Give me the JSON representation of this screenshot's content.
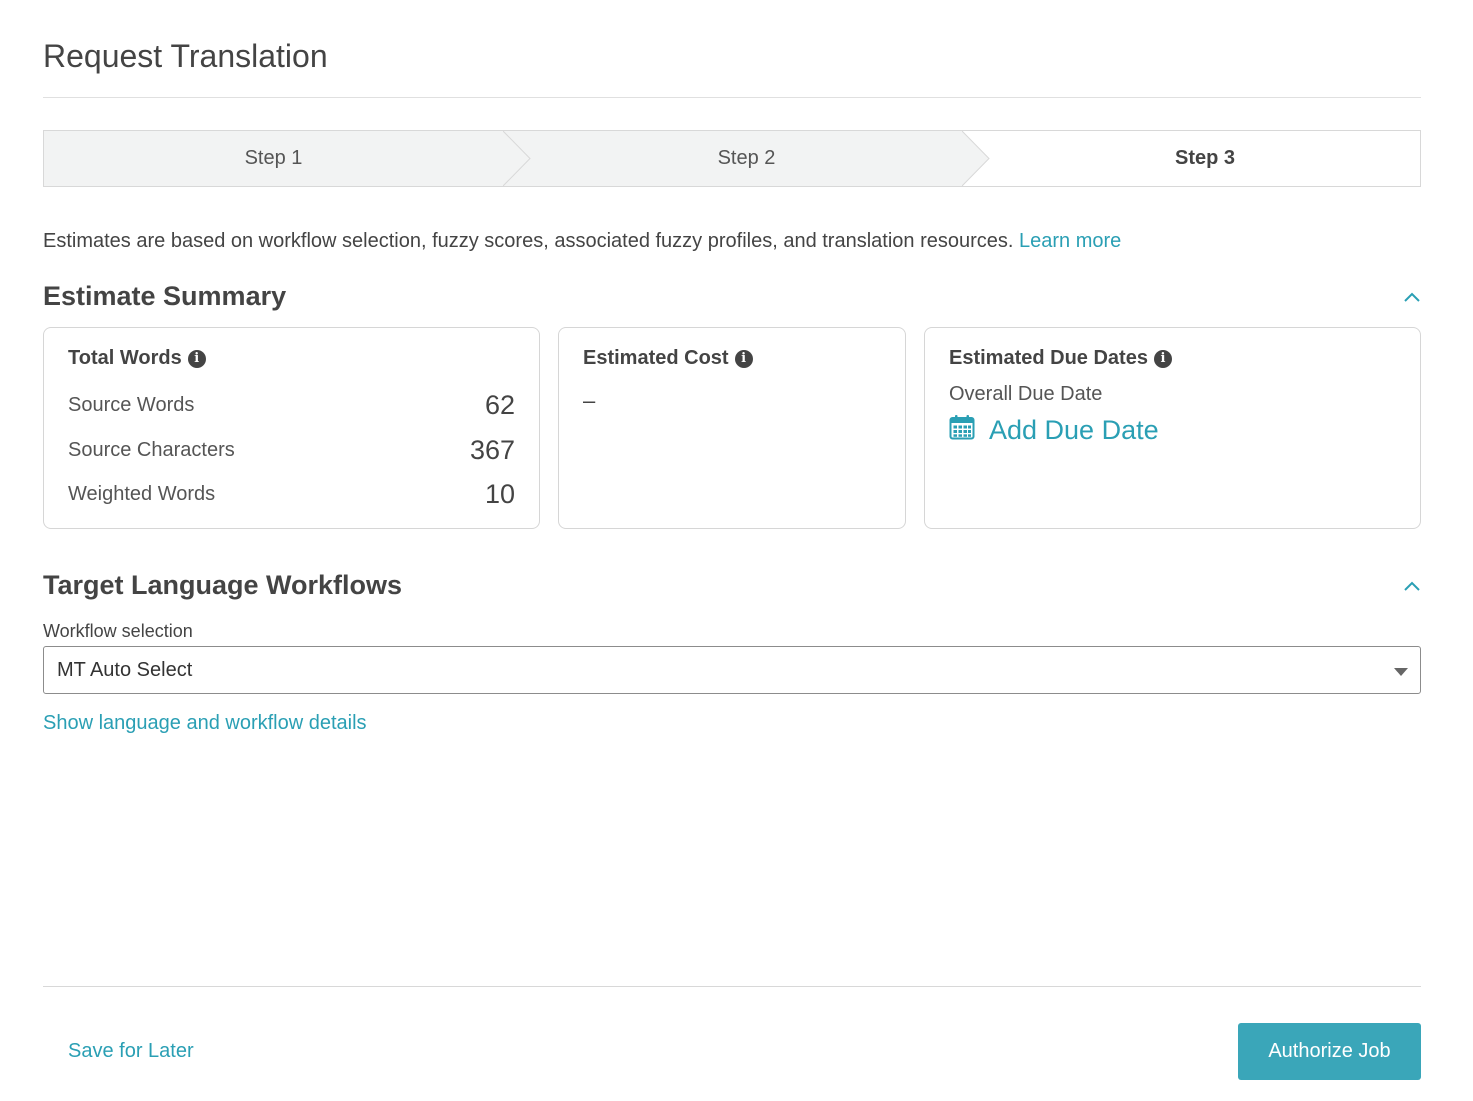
{
  "page": {
    "title": "Request Translation"
  },
  "stepper": {
    "steps": [
      {
        "label": "Step 1",
        "state": "done"
      },
      {
        "label": "Step 2",
        "state": "done"
      },
      {
        "label": "Step 3",
        "state": "active"
      }
    ]
  },
  "intro": {
    "text": "Estimates are based on workflow selection, fuzzy scores, associated fuzzy profiles, and translation resources.",
    "link_label": "Learn more"
  },
  "estimate_summary": {
    "title": "Estimate Summary",
    "total_words": {
      "title": "Total Words",
      "rows": [
        {
          "label": "Source Words",
          "value": "62"
        },
        {
          "label": "Source Characters",
          "value": "367"
        },
        {
          "label": "Weighted Words",
          "value": "10"
        }
      ]
    },
    "estimated_cost": {
      "title": "Estimated Cost",
      "value": "–"
    },
    "estimated_due_dates": {
      "title": "Estimated Due Dates",
      "overall_label": "Overall Due Date",
      "add_label": "Add Due Date"
    }
  },
  "target_workflows": {
    "title": "Target Language Workflows",
    "field_label": "Workflow selection",
    "selected_value": "MT Auto Select",
    "details_link": "Show language and workflow details"
  },
  "footer": {
    "save_label": "Save for Later",
    "authorize_label": "Authorize Job"
  },
  "colors": {
    "accent": "#2a9fb4",
    "button": "#3aa6b9",
    "text": "#444444"
  }
}
